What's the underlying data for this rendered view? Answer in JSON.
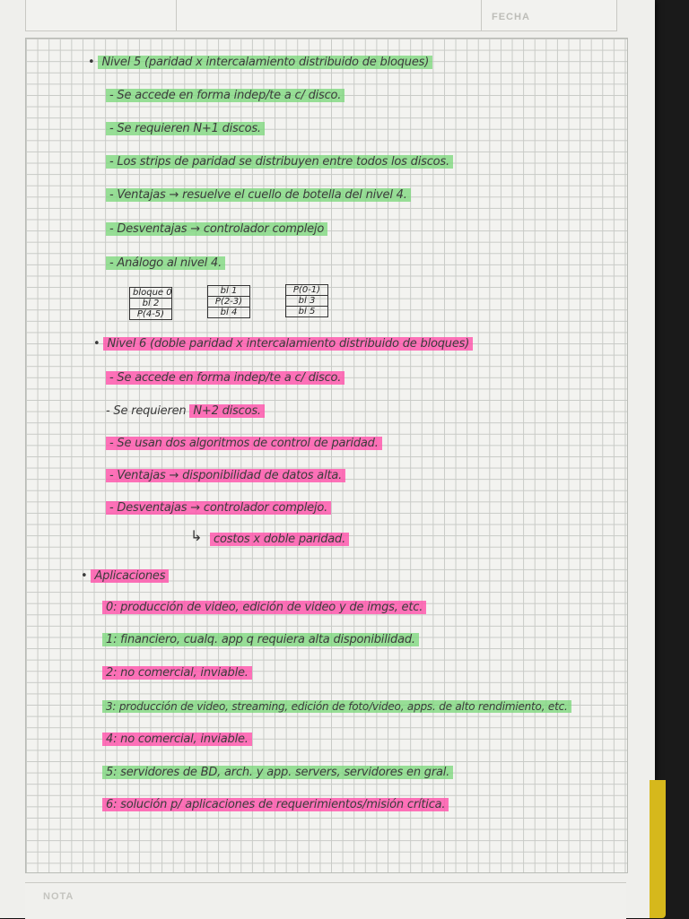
{
  "header": {
    "fecha_label": "FECHA"
  },
  "footer": {
    "nota_label": "NOTA"
  },
  "level5": {
    "title": "Nivel 5 (paridad x intercalamiento distribuido de bloques)",
    "items": [
      "- Se accede en forma indep/te a c/ disco.",
      "- Se requieren N+1 discos.",
      "- Los strips de paridad se distribuyen entre todos los discos.",
      "- Ventajas → resuelve el cuello de botella del nivel 4.",
      "- Desventajas → controlador complejo",
      "- Análogo al nivel 4."
    ],
    "disks": [
      [
        "bloque 0",
        "bl 2",
        "P(4-5)"
      ],
      [
        "bl 1",
        "P(2-3)",
        "bl 4"
      ],
      [
        "P(0-1)",
        "bl 3",
        "bl 5"
      ]
    ]
  },
  "level6": {
    "title": "Nivel 6 (doble paridad x intercalamiento distribuido de bloques)",
    "items": [
      "- Se accede en forma indep/te a c/ disco.",
      "- Se requieren",
      "N+2 discos.",
      "- Se usan dos algoritmos de control de paridad.",
      "- Ventajas → disponibilidad de datos alta.",
      "- Desventajas → controlador complejo.",
      "costos x doble paridad."
    ]
  },
  "apps": {
    "title": "Aplicaciones",
    "items": [
      "0: producción de video, edición de video y de imgs, etc.",
      "1: financiero, cualq. app q requiera alta disponibilidad.",
      "2: no comercial, inviable.",
      "3: producción de video, streaming, edición de foto/video, apps. de alto rendimiento, etc.",
      "4: no comercial, inviable.",
      "5: servidores de BD, arch. y app. servers, servidores en gral.",
      "6: solución p/ aplicaciones de requerimientos/misión crítica."
    ]
  }
}
